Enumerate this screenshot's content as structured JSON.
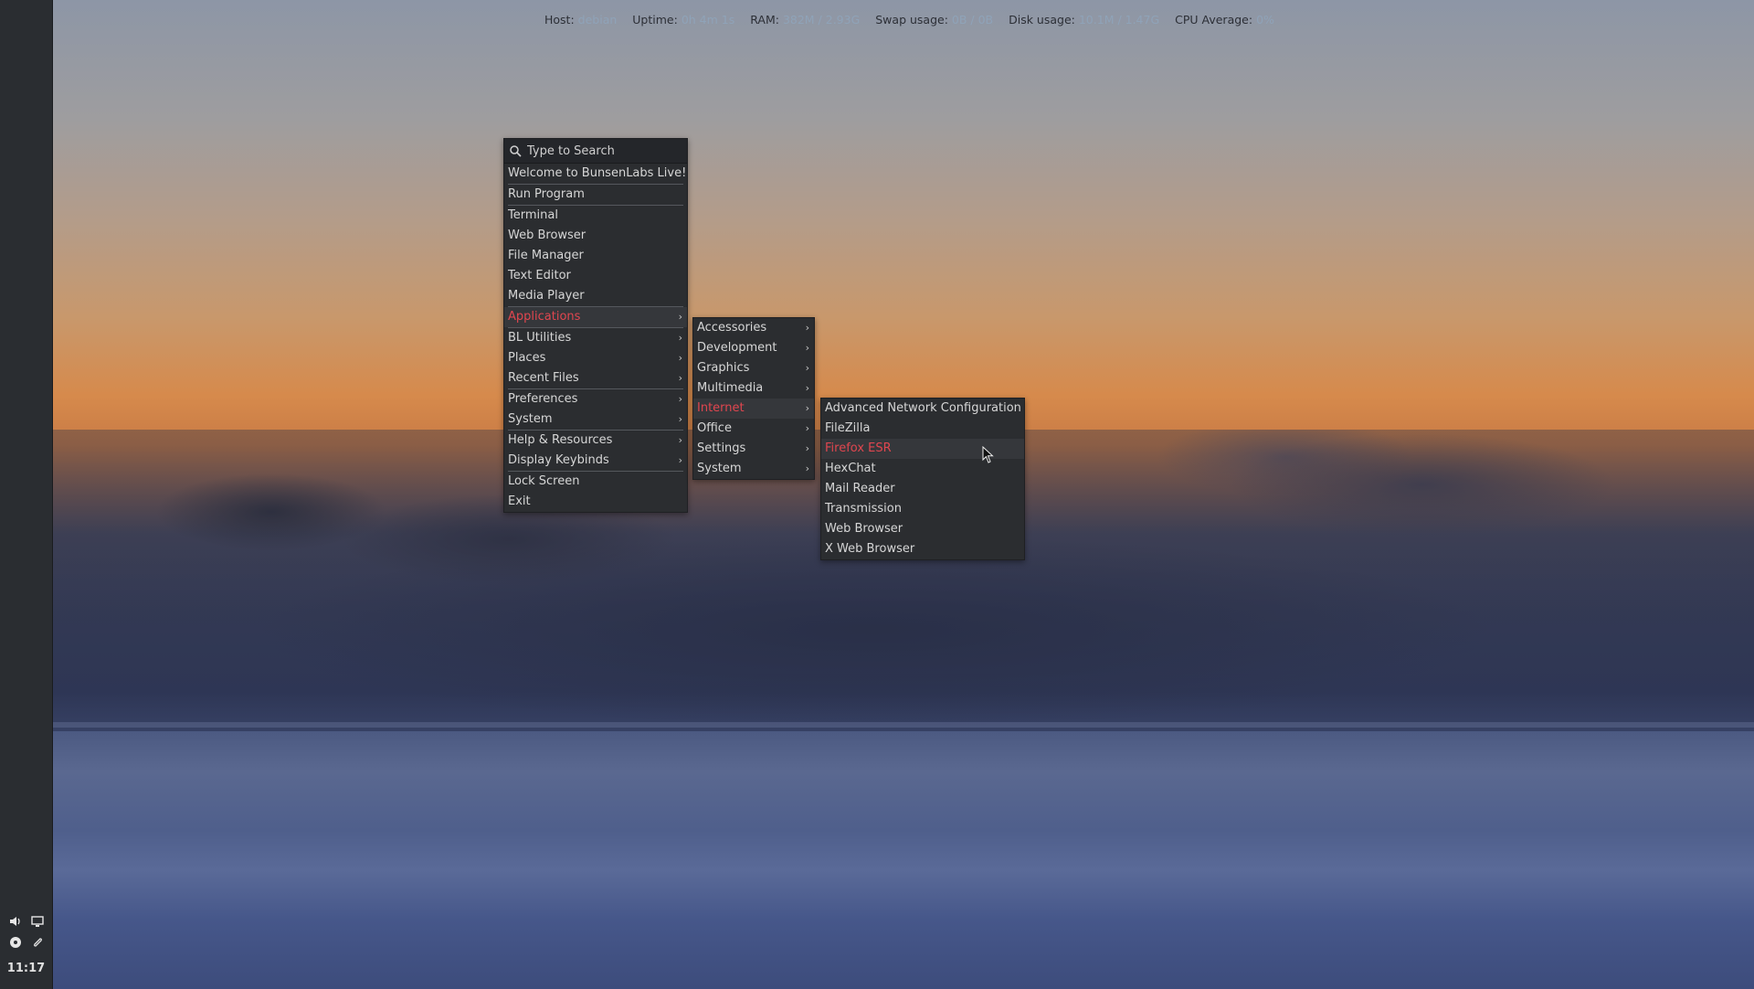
{
  "conky": [
    {
      "key": "Host:",
      "value": "debian"
    },
    {
      "key": "Uptime:",
      "value": "0h 4m 1s"
    },
    {
      "key": "RAM:",
      "value": "382M / 2.93G"
    },
    {
      "key": "Swap usage:",
      "value": "0B / 0B"
    },
    {
      "key": "Disk usage:",
      "value": "10.1M / 1.47G"
    },
    {
      "key": "CPU Average:",
      "value": "0%"
    }
  ],
  "panel": {
    "clock": "11:17",
    "tray_icons": [
      "volume-icon",
      "display-icon",
      "network-icon",
      "clipboard-icon"
    ]
  },
  "main_menu": {
    "search_placeholder": "Type to Search",
    "welcome": "Welcome to BunsenLabs Live!",
    "run_program": "Run Program",
    "quick": [
      "Terminal",
      "Web Browser",
      "File Manager",
      "Text Editor",
      "Media Player"
    ],
    "applications": "Applications",
    "group2": [
      "BL Utilities",
      "Places",
      "Recent Files"
    ],
    "group3": [
      "Preferences",
      "System"
    ],
    "group4": [
      "Help & Resources",
      "Display Keybinds"
    ],
    "lock": "Lock Screen",
    "exit": "Exit"
  },
  "apps_menu": [
    "Accessories",
    "Development",
    "Graphics",
    "Multimedia",
    "Internet",
    "Office",
    "Settings",
    "System"
  ],
  "internet_menu": [
    "Advanced Network Configuration",
    "FileZilla",
    "Firefox ESR",
    "HexChat",
    "Mail Reader",
    "Transmission",
    "Web Browser",
    "X Web Browser"
  ],
  "colors": {
    "accent": "#e0464f",
    "menu_bg": "#2b2d30",
    "panel_bg": "#2a2d31"
  }
}
